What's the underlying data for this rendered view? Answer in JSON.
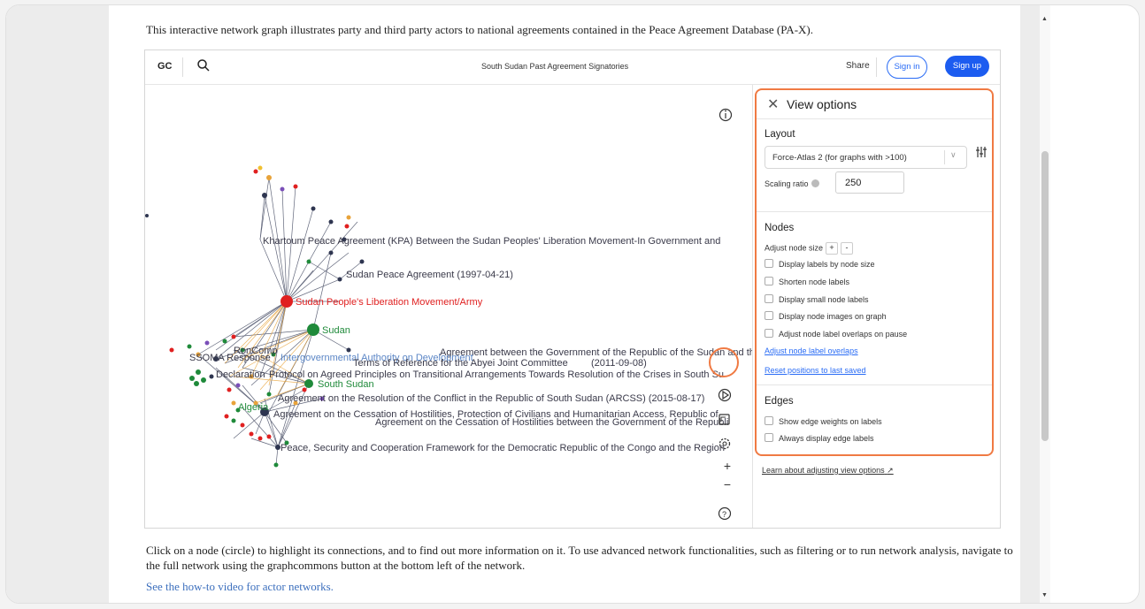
{
  "intro_text": "This interactive network graph illustrates party and third party actors to national agreements contained in the Peace Agreement Database (PA-X).",
  "topbar": {
    "logo": "GC",
    "title": "South Sudan Past Agreement Signatories",
    "share": "Share",
    "sign_in": "Sign in",
    "sign_up": "Sign up"
  },
  "graph_labels": {
    "khartoum": "Khartoum Peace Agreement (KPA) Between the Sudan Peoples' Liberation Movement-In Government and",
    "sudan_peace": "Sudan Peace Agreement (1997-04-21)",
    "splm": "Sudan People's Liberation Movement/Army",
    "sudan": "Sudan",
    "gov_republic": "Agreement between the Government of the Republic of the Sudan and the Sudan Peo",
    "ssoma": "SSOMA Response",
    "roncomp": "RonComp",
    "igad": "Intergovernmental Authority on Development",
    "abyei": "Terms of Reference for the Abyei Joint Committee",
    "abyei_date": "(2011-09-08)",
    "declaration": "Declaration",
    "protocol": "Protocol on Agreed Principles on Transitional Arrangements Towards Resolution of the Crises in South Su",
    "south_sudan": "South Sudan",
    "arcss": "Agreement on the Resolution of the Conflict in the Republic of South Sudan (ARCSS) (2015-08-17)",
    "algeria": "Algeria",
    "cessation_a": "Agreement on the Cessation of Hostilities, Protection of Civilians and Humanitarian Access, Republic of",
    "cessation_b": "Agreement on the Cessation of Hostilities between the Government of the Republi",
    "psc": "Peace, Security and Cooperation Framework for the Democratic Republic of the Congo and the Region"
  },
  "panel": {
    "title": "View options",
    "layout_heading": "Layout",
    "layout_select": "Force-Atlas 2 (for graphs with >100)",
    "scaling_label": "Scaling ratio",
    "scaling_value": "250",
    "nodes_heading": "Nodes",
    "adjust_node_size": "Adjust node size",
    "plus": "+",
    "minus": "-",
    "node_options": [
      "Display labels by node size",
      "Shorten node labels",
      "Display small node labels",
      "Display node images on graph",
      "Adjust node label overlaps on pause"
    ],
    "link_overlaps": "Adjust node label overlaps",
    "link_reset": "Reset positions to last saved",
    "edges_heading": "Edges",
    "edge_options": [
      "Show edge weights on labels",
      "Always display edge labels"
    ],
    "learn": "Learn about adjusting view options"
  },
  "tools": {
    "plus": "+",
    "minus": "−"
  },
  "outro_text": "Click on a node (circle) to highlight its connections, and to find out more information on it. To use advanced network functionalities, such as filtering or to run network analysis, navigate to the full network using the graphcommons button at the bottom left of the network.",
  "howto_link": "See the how-to video for actor networks.",
  "colors": {
    "accent": "#f07a43",
    "brand_blue": "#1c5cf0",
    "splm_red": "#e02020",
    "sudan_green": "#1f8a3a"
  }
}
